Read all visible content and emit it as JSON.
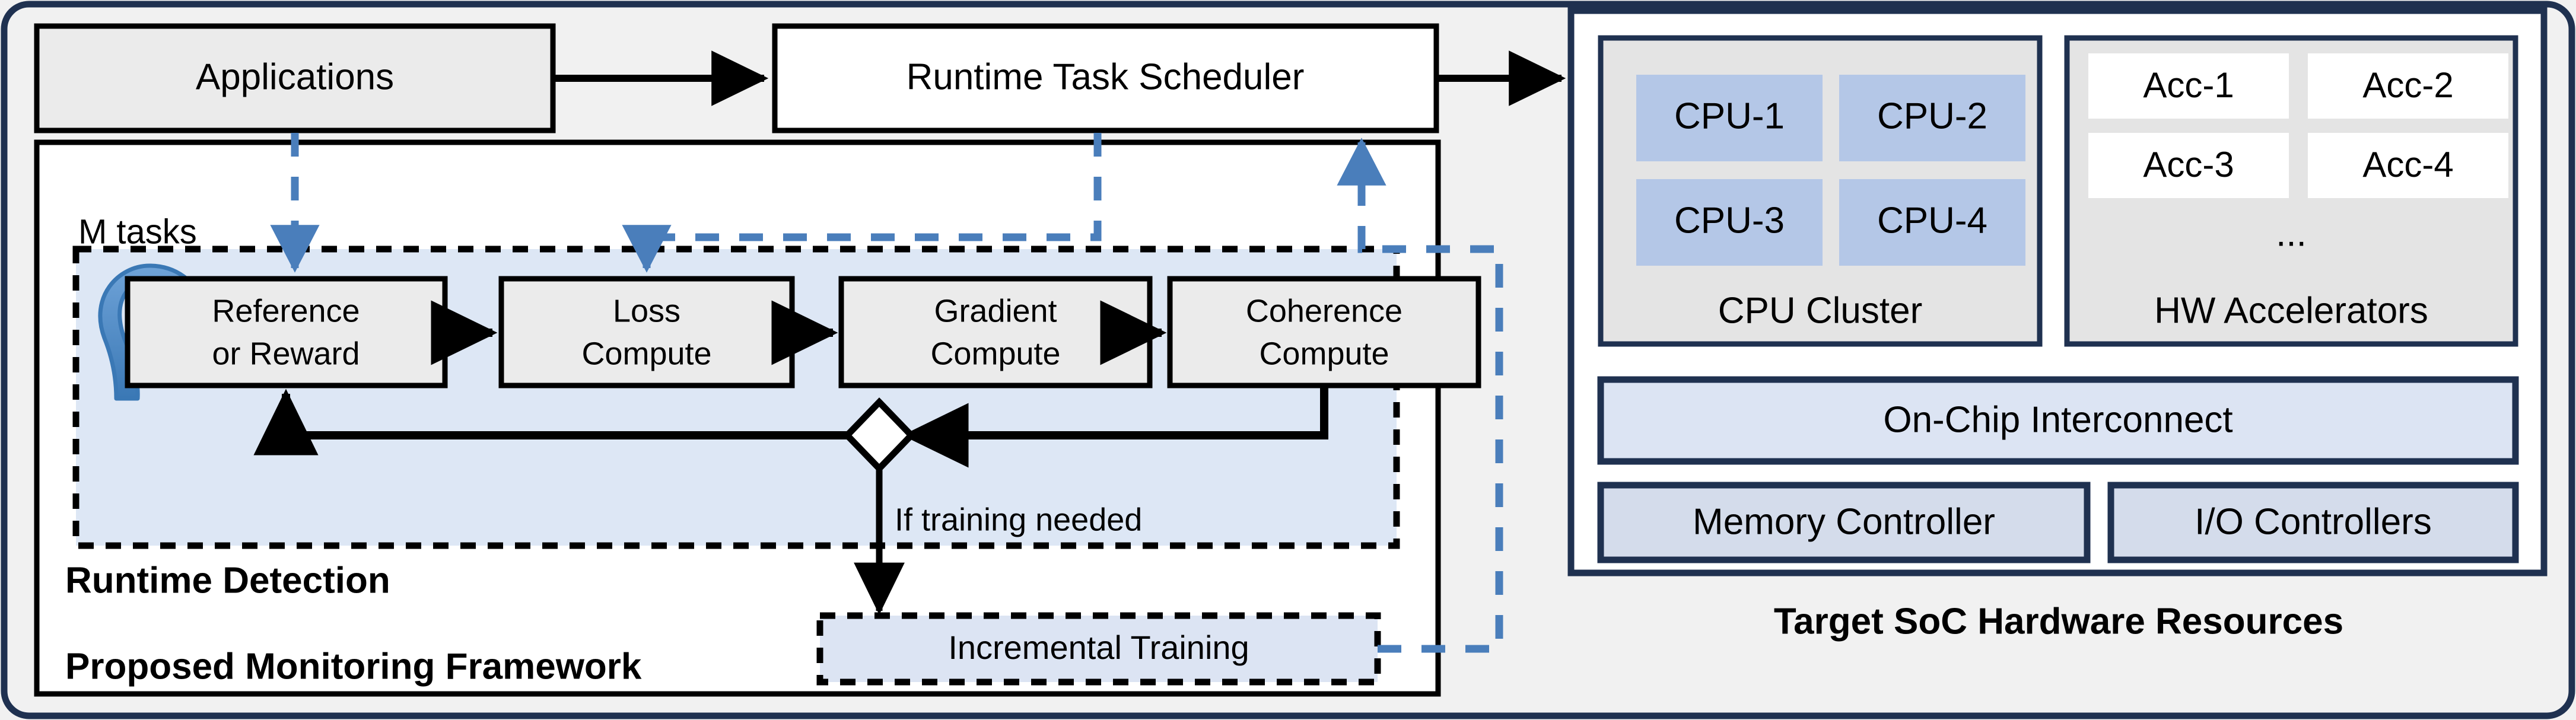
{
  "figure": {
    "title_left": "Proposed Monitoring Framework",
    "title_right": "Target SoC Hardware Resources"
  },
  "colors": {
    "page_bg": "#f1f1f1",
    "outer_border": "#1f3150",
    "box_gray_fill": "#ebebeb",
    "box_white_fill": "#ffffff",
    "box_black_border": "#000000",
    "detection_band_fill": "#dde7f5",
    "cpu_fill": "#b4c7e7",
    "cluster_fill": "#e4e4e4",
    "interconnect_fill": "#dce4f3",
    "controller_fill": "#d4dceb",
    "accent_blue": "#4a7ebb",
    "soc_border": "#1f3150",
    "training_fill": "#dce4f3"
  },
  "top_row": {
    "applications": "Applications",
    "scheduler": "Runtime Task Scheduler"
  },
  "framework": {
    "detection_label": "Runtime Detection",
    "framework_label": "Proposed Monitoring Framework",
    "m_tasks_label": "M tasks",
    "pipeline": [
      {
        "line1": "Reference",
        "line2": "or Reward"
      },
      {
        "line1": "Loss",
        "line2": "Compute"
      },
      {
        "line1": "Gradient",
        "line2": "Compute"
      },
      {
        "line1": "Coherence",
        "line2": "Compute"
      }
    ],
    "decision_label": "If training needed",
    "incremental_training": "Incremental Training"
  },
  "soc": {
    "cpu_cluster_label": "CPU Cluster",
    "cpus": [
      "CPU-1",
      "CPU-2",
      "CPU-3",
      "CPU-4"
    ],
    "accelerators_label": "HW Accelerators",
    "accelerators": [
      "Acc-1",
      "Acc-2",
      "Acc-3",
      "Acc-4"
    ],
    "accelerators_ellipsis": "...",
    "interconnect": "On-Chip Interconnect",
    "memory_controller": "Memory Controller",
    "io_controllers": "I/O Controllers"
  }
}
